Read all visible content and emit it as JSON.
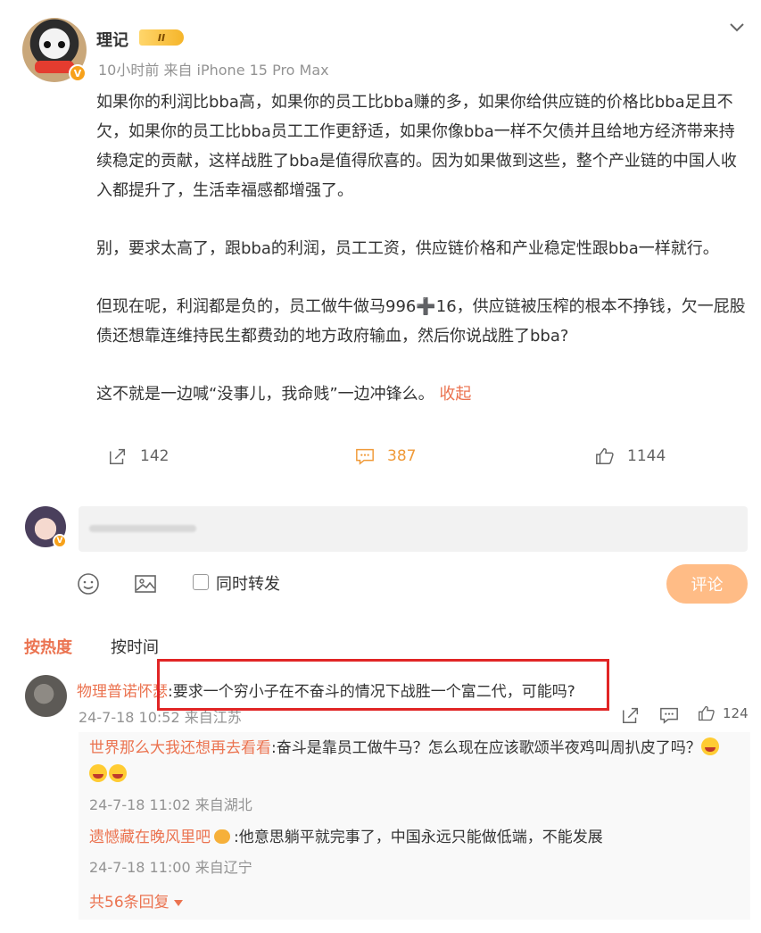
{
  "post": {
    "author": "理记",
    "vip_level": "II",
    "meta": "10小时前 来自 iPhone 15 Pro Max",
    "paragraphs": [
      "如果你的利润比bba高，如果你的员工比bba赚的多，如果你给供应链的价格比bba足且不欠，如果你的员工比bba员工工作更舒适，如果你像bba一样不欠债并且给地方经济带来持续稳定的贡献，这样战胜了bba是值得欣喜的。因为如果做到这些，整个产业链的中国人收入都提升了，生活幸福感都增强了。",
      "别，要求太高了，跟bba的利润，员工工资，供应链价格和产业稳定性跟bba一样就行。",
      "但现在呢，利润都是负的，员工做牛做马996➕16，供应链被压榨的根本不挣钱，欠一屁股债还想靠连维持民生都费劲的地方政府输血，然后你说战胜了bba?",
      "这不就是一边喊“没事儿，我命贱”一边冲锋么。"
    ],
    "collapse_label": "收起",
    "forward_count": "142",
    "comment_count": "387",
    "like_count": "1144"
  },
  "composer": {
    "forward_label": "同时转发",
    "submit_label": "评论"
  },
  "sort": {
    "hot_label": "按热度",
    "time_label": "按时间"
  },
  "comment1": {
    "user": "物理普诺怀瑟",
    "text": ":要求一个穷小子在不奋斗的情况下战胜一个富二代，可能吗?",
    "meta": "24-7-18 10:52 来自江苏",
    "like_count": "124"
  },
  "replies": [
    {
      "user": "世界那么大我还想再去看看",
      "text": ":奋斗是靠员工做牛马？怎么现在应该歌颂半夜鸡叫周扒皮了吗？",
      "meta": "24-7-18 11:02 来自湖北"
    },
    {
      "user": "遗憾藏在晚风里吧",
      "text": ":他意思躺平就完事了，中国永远只能做低端，不能发展",
      "meta": "24-7-18 11:00 来自辽宁"
    }
  ],
  "more_replies_label": "共56条回复",
  "colors": {
    "accent": "#eb7350",
    "comment_active": "#f09a38",
    "submit_bg": "#ffbc86",
    "highlight": "#e12525"
  }
}
